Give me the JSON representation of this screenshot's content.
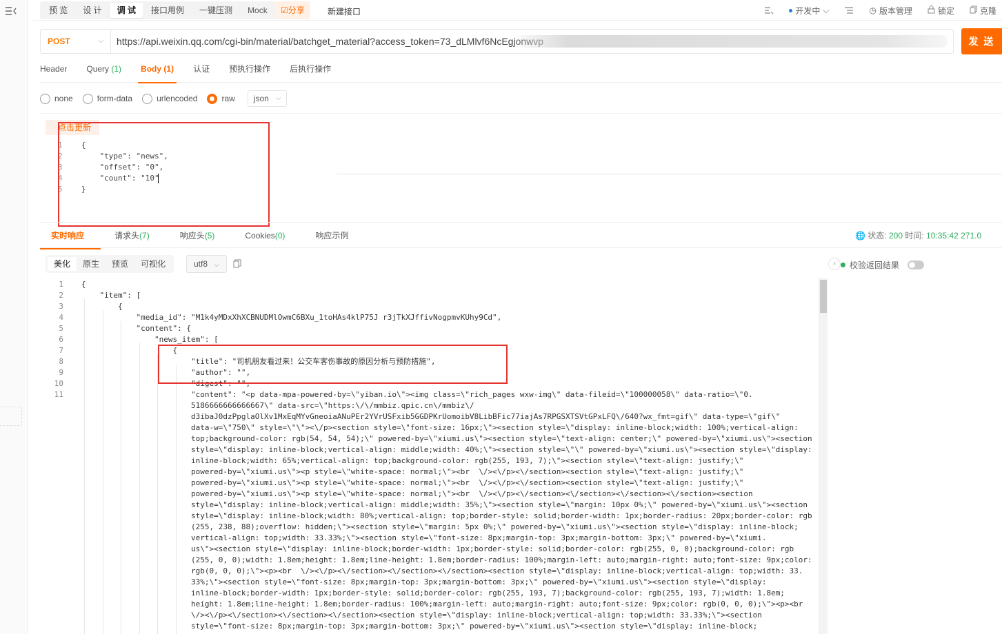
{
  "top_tabs": {
    "items": [
      {
        "label": "预 览",
        "active": false
      },
      {
        "label": "设 计",
        "active": false
      },
      {
        "label": "调 试",
        "active": true
      },
      {
        "label": "接口用例",
        "active": false
      },
      {
        "label": "一键压测",
        "active": false
      },
      {
        "label": "Mock",
        "active": false
      }
    ],
    "share_label": "☑分享",
    "new_api_label": "新建接口"
  },
  "top_right": {
    "status_label": "开发中",
    "version_label": "版本管理",
    "lock_label": "锁定",
    "clone_label": "克隆"
  },
  "request": {
    "method": "POST",
    "url": "https://api.weixin.qq.com/cgi-bin/material/batchget_material?access_token=73_dLMlvf6NcEgjonwvp",
    "send_label": "发 送",
    "tabs": [
      {
        "label": "Header",
        "count": "",
        "active": false
      },
      {
        "label": "Query",
        "count": "(1)",
        "active": false
      },
      {
        "label": "Body",
        "count": "(1)",
        "active": true
      },
      {
        "label": "认证",
        "count": "",
        "active": false
      },
      {
        "label": "预执行操作",
        "count": "",
        "active": false
      },
      {
        "label": "后执行操作",
        "count": "",
        "active": false
      }
    ],
    "body_types": [
      {
        "label": "none",
        "selected": false
      },
      {
        "label": "form-data",
        "selected": false
      },
      {
        "label": "urlencoded",
        "selected": false
      },
      {
        "label": "raw",
        "selected": true
      }
    ],
    "format": "json",
    "refresh_label": "点击更新",
    "body_lines": [
      {
        "n": "1",
        "code": "{"
      },
      {
        "n": "2",
        "code": "    \"type\": \"news\","
      },
      {
        "n": "3",
        "code": "    \"offset\": \"0\","
      },
      {
        "n": "4",
        "code": "    \"count\": \"10\""
      },
      {
        "n": "5",
        "code": "}"
      }
    ]
  },
  "response": {
    "tabs": [
      {
        "label": "实时响应",
        "count": "",
        "active": true
      },
      {
        "label": "请求头",
        "count": "(7)",
        "active": false
      },
      {
        "label": "响应头",
        "count": "(5)",
        "active": false
      },
      {
        "label": "Cookies",
        "count": "(0)",
        "active": false
      },
      {
        "label": "响应示例",
        "count": "",
        "active": false
      }
    ],
    "status_label": "状态:",
    "status_value": "200",
    "time_label": "时间:",
    "time_value": "10:35:42",
    "size_value": "271.0",
    "view_tabs": [
      {
        "label": "美化",
        "active": true
      },
      {
        "label": "原生",
        "active": false
      },
      {
        "label": "预览",
        "active": false
      },
      {
        "label": "可视化",
        "active": false
      }
    ],
    "encoding": "utf8",
    "validate_label": "校验返回结果",
    "lines": [
      {
        "n": "1",
        "indent": 0,
        "text": "{"
      },
      {
        "n": "2",
        "indent": 1,
        "text": "\"item\": ["
      },
      {
        "n": "3",
        "indent": 2,
        "text": "{"
      },
      {
        "n": "4",
        "indent": 3,
        "text": "\"media_id\": \"M1k4yMDxXhXCBNUDMlOwmC6BXu_1toHAs4klP75J r3jTkXJffivNogpmvKUhy9Cd\","
      },
      {
        "n": "5",
        "indent": 3,
        "text": "\"content\": {"
      },
      {
        "n": "6",
        "indent": 4,
        "text": "\"news_item\": ["
      },
      {
        "n": "7",
        "indent": 5,
        "text": "{"
      },
      {
        "n": "8",
        "indent": 6,
        "text": "\"title\": \"司机朋友看过来！公交车客伤事故的原因分析与预防措施\","
      },
      {
        "n": "9",
        "indent": 6,
        "text": "\"author\": \"\","
      },
      {
        "n": "10",
        "indent": 6,
        "text": "\"digest\": \"\","
      },
      {
        "n": "11",
        "indent": 6,
        "text": "\"content\": \"<p data-mpa-powered-by=\\\"yiban.io\\\"><img class=\\\"rich_pages wxw-img\\\" data-fileid=\\\"100000058\\\" data-ratio=\\\"0."
      },
      {
        "n": "",
        "indent": 6,
        "text": "5186666666666667\\\" data-src=\\\"https:\\/\\/mmbiz.qpic.cn\\/mmbiz\\/"
      },
      {
        "n": "",
        "indent": 6,
        "text": "d3ibaJ0dzPpglaOlXv1MxEqMYvGneoiaANuPEr2YVrUSFxib5GGDPKrUomoibV8LibBFic77iajAs7RPGSXTSVtGPxLFQ\\/640?wx_fmt=gif\\\" data-type=\\\"gif\\\""
      },
      {
        "n": "",
        "indent": 6,
        "text": "data-w=\\\"750\\\" style=\\\"\\\"><\\/p><section style=\\\"font-size: 16px;\\\"><section style=\\\"display: inline-block;width: 100%;vertical-align:"
      },
      {
        "n": "",
        "indent": 6,
        "text": "top;background-color: rgb(54, 54, 54);\\\" powered-by=\\\"xiumi.us\\\"><section style=\\\"text-align: center;\\\" powered-by=\\\"xiumi.us\\\"><section"
      },
      {
        "n": "",
        "indent": 6,
        "text": "style=\\\"display: inline-block;vertical-align: middle;width: 40%;\\\"><section style=\\\"\\\" powered-by=\\\"xiumi.us\\\"><section style=\\\"display:"
      },
      {
        "n": "",
        "indent": 6,
        "text": "inline-block;width: 65%;vertical-align: top;background-color: rgb(255, 193, 7);\\\"><section style=\\\"text-align: justify;\\\""
      },
      {
        "n": "",
        "indent": 6,
        "text": "powered-by=\\\"xiumi.us\\\"><p style=\\\"white-space: normal;\\\"><br  \\/><\\/p><\\/section><section style=\\\"text-align: justify;\\\""
      },
      {
        "n": "",
        "indent": 6,
        "text": "powered-by=\\\"xiumi.us\\\"><p style=\\\"white-space: normal;\\\"><br  \\/><\\/p><\\/section><section style=\\\"text-align: justify;\\\""
      },
      {
        "n": "",
        "indent": 6,
        "text": "powered-by=\\\"xiumi.us\\\"><p style=\\\"white-space: normal;\\\"><br  \\/><\\/p><\\/section><\\/section><\\/section><\\/section><section"
      },
      {
        "n": "",
        "indent": 6,
        "text": "style=\\\"display: inline-block;vertical-align: middle;width: 35%;\\\"><section style=\\\"margin: 10px 0%;\\\" powered-by=\\\"xiumi.us\\\"><section"
      },
      {
        "n": "",
        "indent": 6,
        "text": "style=\\\"display: inline-block;width: 80%;vertical-align: top;border-style: solid;border-width: 1px;border-radius: 20px;border-color: rgb"
      },
      {
        "n": "",
        "indent": 6,
        "text": "(255, 238, 88);overflow: hidden;\\\"><section style=\\\"margin: 5px 0%;\\\" powered-by=\\\"xiumi.us\\\"><section style=\\\"display: inline-block;"
      },
      {
        "n": "",
        "indent": 6,
        "text": "vertical-align: top;width: 33.33%;\\\"><section style=\\\"font-size: 8px;margin-top: 3px;margin-bottom: 3px;\\\" powered-by=\\\"xiumi."
      },
      {
        "n": "",
        "indent": 6,
        "text": "us\\\"><section style=\\\"display: inline-block;border-width: 1px;border-style: solid;border-color: rgb(255, 0, 0);background-color: rgb"
      },
      {
        "n": "",
        "indent": 6,
        "text": "(255, 0, 0);width: 1.8em;height: 1.8em;line-height: 1.8em;border-radius: 100%;margin-left: auto;margin-right: auto;font-size: 9px;color:"
      },
      {
        "n": "",
        "indent": 6,
        "text": "rgb(0, 0, 0);\\\"><p><br  \\/><\\/p><\\/section><\\/section><\\/section><section style=\\\"display: inline-block;vertical-align: top;width: 33."
      },
      {
        "n": "",
        "indent": 6,
        "text": "33%;\\\"><section style=\\\"font-size: 8px;margin-top: 3px;margin-bottom: 3px;\\\" powered-by=\\\"xiumi.us\\\"><section style=\\\"display:"
      },
      {
        "n": "",
        "indent": 6,
        "text": "inline-block;border-width: 1px;border-style: solid;border-color: rgb(255, 193, 7);background-color: rgb(255, 193, 7);width: 1.8em;"
      },
      {
        "n": "",
        "indent": 6,
        "text": "height: 1.8em;line-height: 1.8em;border-radius: 100%;margin-left: auto;margin-right: auto;font-size: 9px;color: rgb(0, 0, 0);\\\"><p><br"
      },
      {
        "n": "",
        "indent": 6,
        "text": "\\/><\\/p><\\/section><\\/section><\\/section><section style=\\\"display: inline-block;vertical-align: top;width: 33.33%;\\\"><section"
      },
      {
        "n": "",
        "indent": 6,
        "text": "style=\\\"font-size: 8px;margin-top: 3px;margin-bottom: 3px;\\\" powered-by=\\\"xiumi.us\\\"><section style=\\\"display: inline-block;"
      }
    ]
  },
  "colors": {
    "accent": "#ff6a00",
    "count_green": "#2fae60",
    "annotation_red": "#e5332e",
    "json_key": "#8b2c1d"
  }
}
